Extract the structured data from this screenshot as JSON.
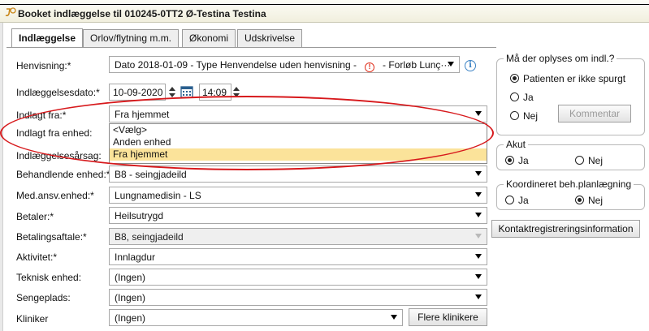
{
  "window": {
    "title": "Booket indlæggelse til 010245-0TT2 Ø-Testina Testina"
  },
  "tabs": [
    {
      "label": "Indlæggelse",
      "active": true
    },
    {
      "label": "Orlov/flytning m.m.",
      "active": false
    },
    {
      "label": "Økonomi",
      "active": false
    },
    {
      "label": "Udskrivelse",
      "active": false
    }
  ],
  "form": {
    "henvisning": {
      "label": "Henvisning:*",
      "value_part1": "Dato 2018-01-09 - Type Henvendelse uden henvisning -",
      "status_glyph": "!",
      "value_part2": "- Forløb Lunç···"
    },
    "indlaeggelsesdato": {
      "label": "Indlæggelsesdato:*",
      "date": "10-09-2020",
      "time": "14:09"
    },
    "indlagt_fra": {
      "label": "Indlagt fra:*",
      "value": "Fra hjemmet",
      "options": [
        "<Vælg>",
        "Anden enhed",
        "Fra hjemmet"
      ],
      "selected_option_index": 2
    },
    "indlagt_fra_enhed": {
      "label": "Indlagt fra enhed:"
    },
    "indlaeggelsesaarsag": {
      "label": "Indlæggelsesårsag:"
    },
    "behandlende_enhed": {
      "label": "Behandlende enhed:*",
      "value": "B8 - seingjadeild"
    },
    "med_ansv_enhed": {
      "label": "Med.ansv.enhed:*",
      "value": "Lungnamedisin - LS"
    },
    "betaler": {
      "label": "Betaler:*",
      "value": "Heilsutrygd"
    },
    "betalingsaftale": {
      "label": "Betalingsaftale:*",
      "value": "B8, seingjadeild"
    },
    "aktivitet": {
      "label": "Aktivitet:*",
      "value": "Innlagdur"
    },
    "teknisk_enhed": {
      "label": "Teknisk enhed:",
      "value": "(Ingen)"
    },
    "sengeplads": {
      "label": "Sengeplads:",
      "value": "(Ingen)"
    },
    "kliniker": {
      "label": "Kliniker",
      "value": "(Ingen)",
      "button": "Flere klinikere"
    }
  },
  "side": {
    "oplyses": {
      "title": "Må der oplyses om indl.?",
      "options": [
        "Patienten er ikke spurgt",
        "Ja",
        "Nej"
      ],
      "selected_index": 0,
      "kommentar_button": "Kommentar"
    },
    "akut": {
      "title": "Akut",
      "options": [
        "Ja",
        "Nej"
      ],
      "selected_index": 0
    },
    "koordineret": {
      "title": "Koordineret beh.planlægning",
      "options": [
        "Ja",
        "Nej"
      ],
      "selected_index": 1
    },
    "kontakt_button": "Kontaktregistreringsinformation"
  },
  "colors": {
    "highlight": "#fbe39a",
    "annotation_red": "#d7191c",
    "info_blue": "#3b82c4"
  }
}
